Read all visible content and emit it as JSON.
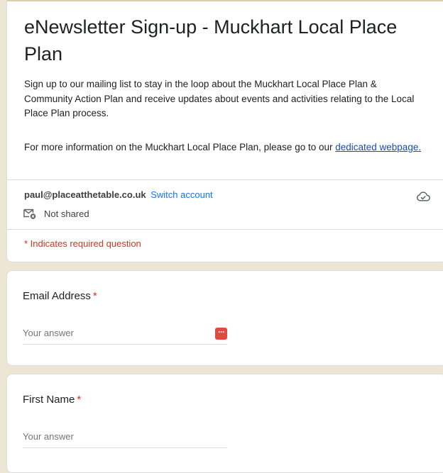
{
  "form": {
    "title": "eNewsletter Sign-up - Muckhart Local Place Plan",
    "description_1": "Sign up to our mailing list to stay in the loop about the Muckhart Local Place Plan & Community Action Plan and receive updates about events and activities relating to the Local Place Plan process.",
    "description_2_text": "For more information on the Muckhart Local Place Plan, please go to our ",
    "description_2_link": "dedicated webpage.",
    "required_note": "* Indicates required question"
  },
  "account": {
    "email": "paul@placeatthetable.co.uk",
    "switch_label": "Switch account",
    "not_shared_label": "Not shared",
    "cloud_icon": "cloud-saved-icon"
  },
  "questions": [
    {
      "label": "Email Address",
      "required_marker": "*",
      "placeholder": "Your answer",
      "has_password_manager_icon": true
    },
    {
      "label": "First Name",
      "required_marker": "*",
      "placeholder": "Your answer"
    }
  ],
  "colors": {
    "page_background": "#ede6d4",
    "header_accent": "#d9cfae",
    "required_red": "#d93025",
    "link_blue": "#1a73e8",
    "password_icon_red": "#e04a3f"
  }
}
